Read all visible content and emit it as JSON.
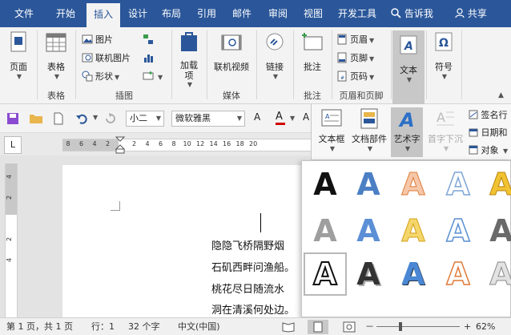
{
  "tabs": [
    {
      "label": "文件"
    },
    {
      "label": "开始"
    },
    {
      "label": "插入"
    },
    {
      "label": "设计"
    },
    {
      "label": "布局"
    },
    {
      "label": "引用"
    },
    {
      "label": "邮件"
    },
    {
      "label": "审阅"
    },
    {
      "label": "视图"
    },
    {
      "label": "开发工具"
    }
  ],
  "search_label": "告诉我",
  "share_label": "共享",
  "ribbon": {
    "pages": {
      "btn": "页面"
    },
    "table": {
      "btn": "表格",
      "group": "表格"
    },
    "illustrations": {
      "pictures": "图片",
      "online_pictures": "联机图片",
      "shapes": "形状",
      "group": "插图"
    },
    "addins": {
      "btn": "加载\n项"
    },
    "media": {
      "btn": "联机视频",
      "group": "媒体"
    },
    "links": {
      "btn": "链接"
    },
    "comments": {
      "btn": "批注",
      "group": "批注"
    },
    "header_footer": {
      "header": "页眉",
      "footer": "页脚",
      "page_number": "页码",
      "group": "页眉和页脚"
    },
    "text": {
      "btn": "文本"
    },
    "symbols": {
      "btn": "符号"
    }
  },
  "format": {
    "font_size": "小二",
    "font_name": "微软雅黑",
    "font_color": "#d00000"
  },
  "ruler": {
    "h_ticks": [
      "8",
      "6",
      "4",
      "2",
      "",
      "2",
      "4",
      "6",
      "8",
      "10",
      "12",
      "14",
      "16",
      "18",
      "20"
    ],
    "v_ticks": [
      "4",
      "2",
      "",
      "2",
      "4"
    ],
    "corner": "L"
  },
  "document": {
    "lines": [
      "隐隐飞桥隔野烟",
      "石矶西畔问渔船。",
      "桃花尽日随流水",
      "洞在清溪何处边。"
    ]
  },
  "text_panel": {
    "textbox": "文本框",
    "quickparts": "文档部件",
    "wordart": "艺术字",
    "dropcap": "首字下沉",
    "signature": "签名行",
    "datetime": "日期和",
    "object": "对象"
  },
  "wordart_gallery": [
    {
      "glyph": "A",
      "style": "black"
    },
    {
      "glyph": "A",
      "style": "blue"
    },
    {
      "glyph": "A",
      "style": "orange-outline"
    },
    {
      "glyph": "A",
      "style": "light-blue-outline"
    },
    {
      "glyph": "A",
      "style": "gold"
    },
    {
      "glyph": "A",
      "style": "gray-gradient"
    },
    {
      "glyph": "A",
      "style": "blue-reflection"
    },
    {
      "glyph": "A",
      "style": "gold-soft"
    },
    {
      "glyph": "A",
      "style": "white-outline"
    },
    {
      "glyph": "A",
      "style": "dark-gray"
    },
    {
      "glyph": "A",
      "style": "black-outline-white"
    },
    {
      "glyph": "A",
      "style": "dark-shadow"
    },
    {
      "glyph": "A",
      "style": "blue-bevel"
    },
    {
      "glyph": "A",
      "style": "orange-white"
    },
    {
      "glyph": "A",
      "style": "silver-bevel"
    }
  ],
  "status": {
    "page": "第 1 页，共 1 页",
    "line": "行：1",
    "words": "32 个字",
    "language": "中文(中国)",
    "zoom": "62%",
    "zoom_minus": "－",
    "zoom_plus": "+"
  }
}
